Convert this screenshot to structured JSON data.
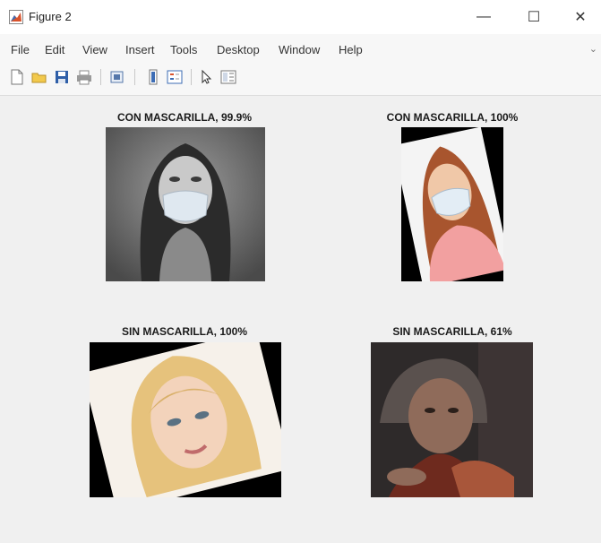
{
  "window": {
    "title": "Figure 2",
    "minimize_glyph": "—",
    "maximize_glyph": "☐",
    "close_glyph": "✕"
  },
  "menu": [
    "File",
    "Edit",
    "View",
    "Insert",
    "Tools",
    "Desktop",
    "Window",
    "Help"
  ],
  "menu_overflow_glyph": "⌄",
  "toolbar_icons": [
    "new-figure-icon",
    "open-file-icon",
    "save-icon",
    "print-icon",
    "link-plot-icon",
    "insert-colorbar-icon",
    "insert-legend-icon",
    "pointer-icon",
    "property-editor-icon"
  ],
  "panels": [
    {
      "title": "CON MASCARILLA, 99.9%",
      "image": "woman-hood-mask-photo"
    },
    {
      "title": "CON MASCARILLA, 100%",
      "image": "woman-red-hair-mask-photo"
    },
    {
      "title": "SIN MASCARILLA, 100%",
      "image": "blonde-woman-face-photo"
    },
    {
      "title": "SIN MASCARILLA, 61%",
      "image": "elderly-woman-photo"
    }
  ],
  "colors": {
    "figure_bg": "#f0f0f0",
    "titlebar_bg": "#ffffff",
    "accent": "#1a1a1a"
  }
}
